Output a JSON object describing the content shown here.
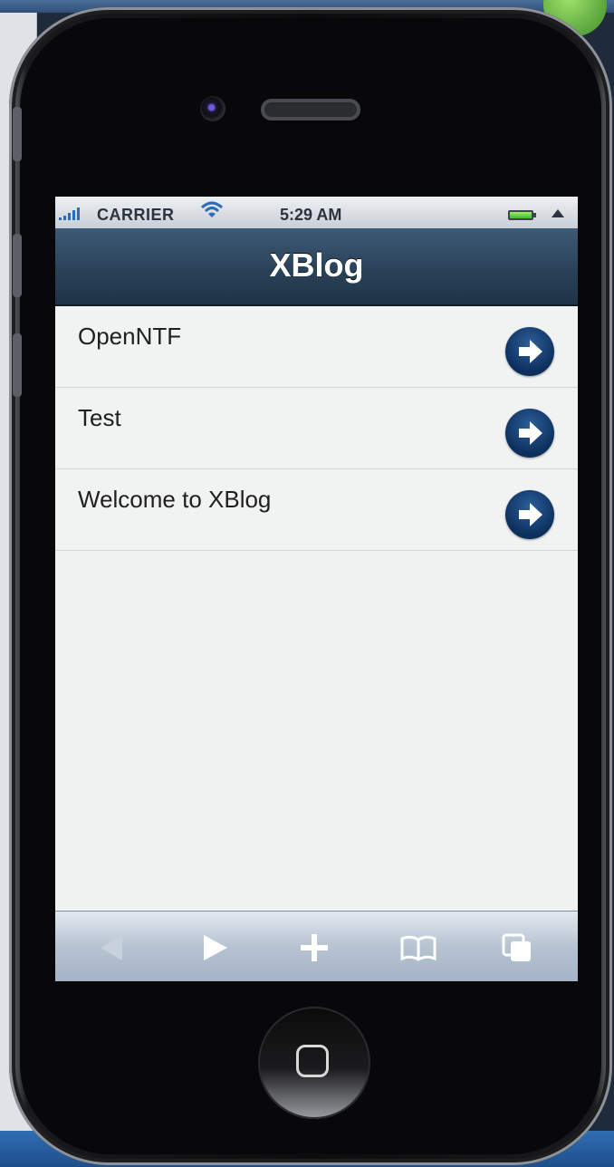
{
  "status_bar": {
    "carrier": "CARRIER",
    "time": "5:29 AM",
    "signal_icon": "signal-bars-icon",
    "wifi_icon": "wifi-icon",
    "battery_icon": "battery-icon"
  },
  "nav": {
    "title": "XBlog"
  },
  "list": {
    "items": [
      {
        "label": "OpenNTF",
        "icon": "arrow-right-circle-icon"
      },
      {
        "label": "Test",
        "icon": "arrow-right-circle-icon"
      },
      {
        "label": "Welcome to XBlog",
        "icon": "arrow-right-circle-icon"
      }
    ]
  },
  "toolbar": {
    "buttons": [
      {
        "icon": "back-arrow-icon",
        "enabled": false
      },
      {
        "icon": "forward-arrow-icon",
        "enabled": true
      },
      {
        "icon": "add-icon",
        "enabled": true
      },
      {
        "icon": "bookmarks-icon",
        "enabled": true
      },
      {
        "icon": "pages-icon",
        "enabled": true
      }
    ]
  },
  "colors": {
    "navbar": "#2a4258",
    "list_background": "#f1f3f2",
    "arrow_button": "#0c2f5c",
    "toolbar": "#b7c3d2"
  }
}
